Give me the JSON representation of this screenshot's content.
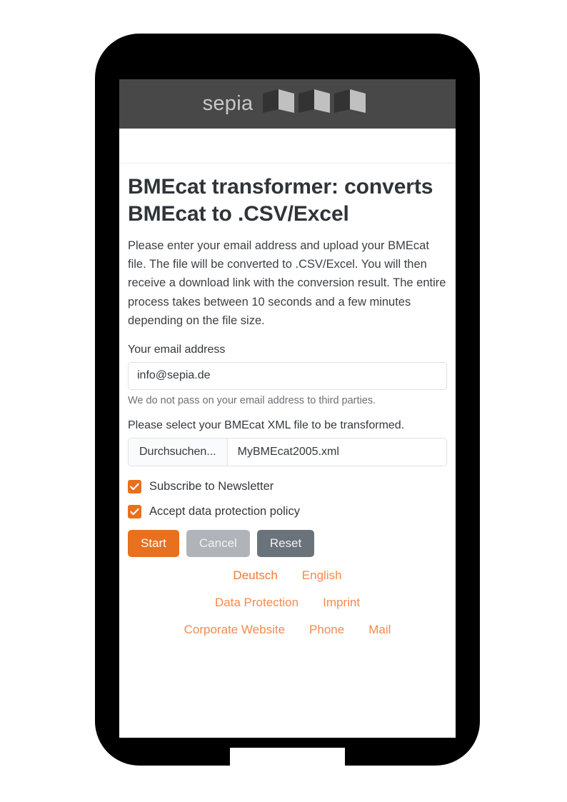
{
  "device": {
    "type": "smartphone-mockup",
    "frame_color": "#000000",
    "home_button": "home-button"
  },
  "header": {
    "brand": "sepia",
    "logo_icon": "sepia-folded-pages-logo",
    "background": "#484848",
    "brand_color": "#c8c8c8"
  },
  "main": {
    "title": "BMEcat transformer: converts BMEcat to .CSV/Excel",
    "intro": "Please enter your email address and upload your BMEcat file. The file will be converted to .CSV/Excel. You will then receive a download link with the conversion result. The entire process takes between 10 seconds and a few minutes depending on the file size.",
    "email": {
      "label": "Your email address",
      "value": "info@sepia.de",
      "placeholder": "Your email address",
      "help": "We do not pass on your email address to third parties."
    },
    "file": {
      "label": "Please select your BMEcat XML file to be transformed.",
      "browse_button": "Durchsuchen...",
      "filename": "MyBMEcat2005.xml"
    },
    "checkboxes": [
      {
        "label": "Subscribe to Newsletter",
        "checked": true
      },
      {
        "label": "Accept data protection policy",
        "checked": true
      }
    ],
    "buttons": {
      "start": "Start",
      "cancel": "Cancel",
      "reset": "Reset"
    }
  },
  "footer": {
    "languages": [
      {
        "label": "Deutsch",
        "active": true
      },
      {
        "label": "English",
        "active": false
      }
    ],
    "legal": [
      {
        "label": "Data Protection"
      },
      {
        "label": "Imprint"
      }
    ],
    "contact": [
      {
        "label": "Corporate Website"
      },
      {
        "label": "Phone"
      },
      {
        "label": "Mail"
      }
    ]
  },
  "colors": {
    "accent": "#e8701e",
    "link": "#f58a4b",
    "header_bg": "#484848",
    "text": "#33383d",
    "muted": "#6a7178"
  }
}
